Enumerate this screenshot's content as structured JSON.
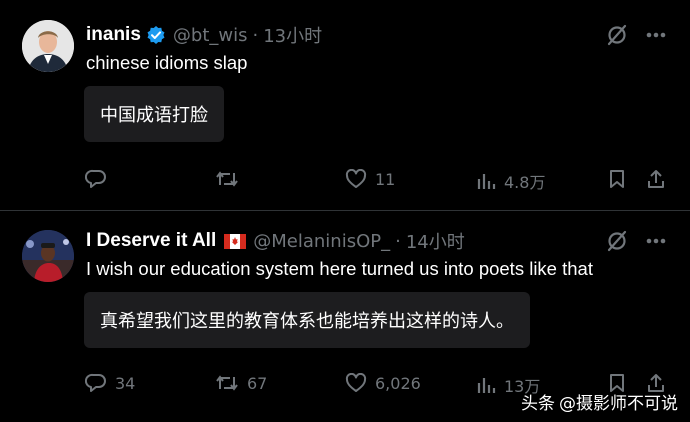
{
  "posts": [
    {
      "author": "inanis",
      "handle": "@bt_wis",
      "separator": "·",
      "time": "13小时",
      "text": "chinese idioms slap",
      "quote": "中国成语打脸",
      "replies": "",
      "retweets": "",
      "likes": "11",
      "views": "4.8万"
    },
    {
      "author": "I Deserve it All",
      "handle": "@MelaninisOP_",
      "separator": "·",
      "time": "14小时",
      "text": "I wish our education system here turned us into poets like that",
      "quote": "真希望我们这里的教育体系也能培养出这样的诗人。",
      "replies": "34",
      "retweets": "67",
      "likes": "6,026",
      "views": "13万"
    }
  ],
  "watermark": {
    "prefix": "头条",
    "text": "@摄影师不可说"
  },
  "colors": {
    "background": "#000000",
    "muted": "#71767b",
    "verified": "#1d9bf0",
    "quote_bg": "#1d1d1f"
  }
}
